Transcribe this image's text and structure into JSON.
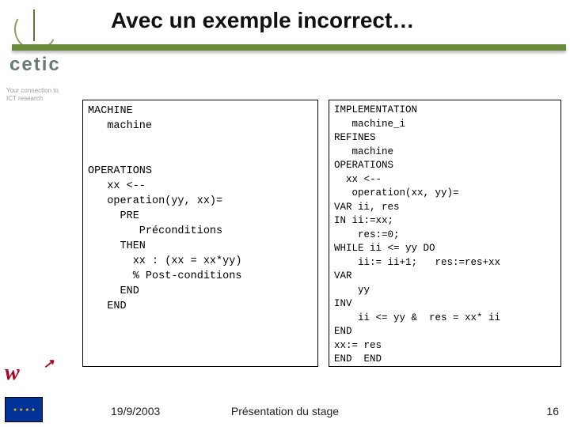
{
  "title": "Avec un exemple incorrect…",
  "logo": {
    "brand": "cetic",
    "tagline_l1": "Your connection to",
    "tagline_l2": "ICT research",
    "w_mark": "w",
    "eu_stars": "★ ★ ★ ★"
  },
  "code_left": "MACHINE\n   machine\n\n\nOPERATIONS\n   xx <--\n   operation(yy, xx)=\n     PRE\n        Préconditions\n     THEN\n       xx : (xx = xx*yy)\n       % Post-conditions\n     END\n   END",
  "code_right": "IMPLEMENTATION\n   machine_i\nREFINES\n   machine\nOPERATIONS\n  xx <--\n   operation(xx, yy)=\nVAR ii, res\nIN ii:=xx;\n    res:=0;\nWHILE ii <= yy DO\n    ii:= ii+1;   res:=res+xx\nVAR\n    yy\nINV\n    ii <= yy &  res = xx* ii\nEND\nxx:= res\nEND  END",
  "footer": {
    "date": "19/9/2003",
    "center": "Présentation du stage",
    "page": "16"
  }
}
